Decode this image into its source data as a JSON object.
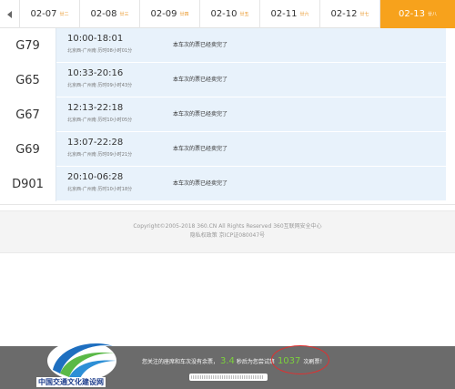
{
  "date_tabs": [
    {
      "date": "02-07",
      "weekday": "廿二",
      "active": false
    },
    {
      "date": "02-08",
      "weekday": "廿三",
      "active": false
    },
    {
      "date": "02-09",
      "weekday": "廿四",
      "active": false
    },
    {
      "date": "02-10",
      "weekday": "廿五",
      "active": false
    },
    {
      "date": "02-11",
      "weekday": "廿六",
      "active": false
    },
    {
      "date": "02-12",
      "weekday": "廿七",
      "active": false
    },
    {
      "date": "02-13",
      "weekday": "廿八",
      "active": true
    }
  ],
  "trains": [
    {
      "number": "G79",
      "time": "10:00-18:01",
      "detail": "北京西-广州南 历时08小时01分",
      "status": "本车次的票已经卖完了"
    },
    {
      "number": "G65",
      "time": "10:33-20:16",
      "detail": "北京西-广州南 历时09小时43分",
      "status": "本车次的票已经卖完了"
    },
    {
      "number": "G67",
      "time": "12:13-22:18",
      "detail": "北京西-广州南 历时10小时05分",
      "status": "本车次的票已经卖完了"
    },
    {
      "number": "G69",
      "time": "13:07-22:28",
      "detail": "北京西-广州南 历时09小时21分",
      "status": "本车次的票已经卖完了"
    },
    {
      "number": "D901",
      "time": "20:10-06:28",
      "detail": "北京西-广州南 历时10小时18分",
      "status": "本车次的票已经卖完了"
    }
  ],
  "footer": {
    "copyright": "Copyright©2005-2018 360.CN All Rights Reserved 360互联网安全中心",
    "links": "隐私权政策 京ICP证080047号"
  },
  "notice": {
    "prefix": "您关注的座席和车次没有余票，",
    "seconds": "3.4",
    "middle": "秒后为您尝试第",
    "attempt": "1037",
    "suffix": "次刷票！"
  },
  "logo_text": "中国交通文化建设网",
  "progress": 0.97,
  "colors": {
    "active_tab": "#f7a21c",
    "row_bg": "#e8f2fb",
    "accent_green": "#7cd23c",
    "circle_red": "#e03030"
  }
}
